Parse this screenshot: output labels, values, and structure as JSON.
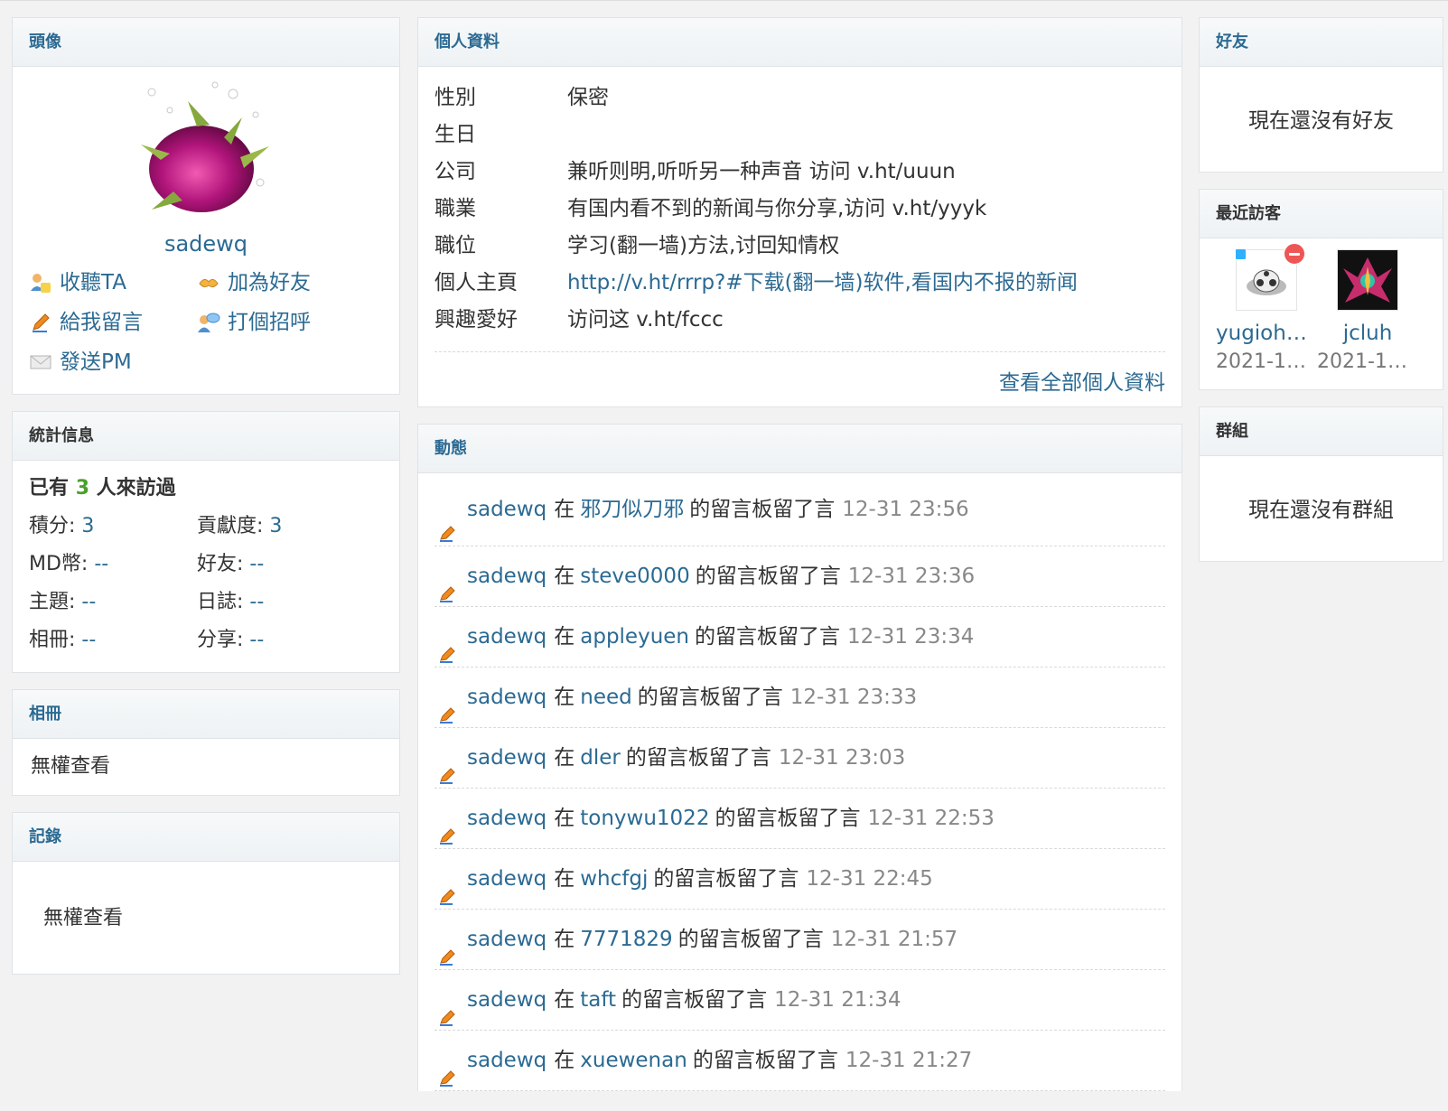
{
  "avatar_box": {
    "title": "頭像",
    "username": "sadewq",
    "actions": [
      {
        "label": "收聽TA",
        "icon": "follow-icon"
      },
      {
        "label": "加為好友",
        "icon": "add-friend-icon"
      },
      {
        "label": "給我留言",
        "icon": "pencil-icon"
      },
      {
        "label": "打個招呼",
        "icon": "greet-icon"
      },
      {
        "label": "發送PM",
        "icon": "mail-icon"
      }
    ]
  },
  "stats_box": {
    "title": "統計信息",
    "visited_prefix": "已有",
    "visited_count": "3",
    "visited_suffix": "人來訪過",
    "items": [
      {
        "label": "積分: ",
        "value": "3"
      },
      {
        "label": "貢獻度: ",
        "value": "3"
      },
      {
        "label": "MD幣: ",
        "value": "--"
      },
      {
        "label": "好友: ",
        "value": "--"
      },
      {
        "label": "主題: ",
        "value": "--"
      },
      {
        "label": "日誌: ",
        "value": "--"
      },
      {
        "label": "相冊: ",
        "value": "--"
      },
      {
        "label": "分享: ",
        "value": "--"
      }
    ]
  },
  "album_box": {
    "title": "相冊",
    "text": "無權查看"
  },
  "record_box": {
    "title": "記錄",
    "text": "無權查看"
  },
  "profile_box": {
    "title": "個人資料",
    "rows": [
      {
        "key": "性別",
        "value": "保密"
      },
      {
        "key": "生日",
        "value": ""
      },
      {
        "key": "公司",
        "value": "兼听则明,听听另一种声音 访问 v.ht/uuun"
      },
      {
        "key": "職業",
        "value": "有国内看不到的新闻与你分享,访问 v.ht/yyyk"
      },
      {
        "key": "職位",
        "value": "学习(翻一墙)方法,讨回知情权"
      },
      {
        "key": "個人主頁",
        "value": "http://v.ht/rrrp?#下载(翻一墙)软件,看国内不报的新闻"
      },
      {
        "key": "興趣愛好",
        "value": "访问这 v.ht/fccc"
      }
    ],
    "more_link": "查看全部個人資料"
  },
  "feed_box": {
    "title": "動態",
    "connector": "在",
    "suffix": "的留言板留了言",
    "items": [
      {
        "user": "sadewq",
        "target": "邪刀似刀邪",
        "time": "12-31 23:56"
      },
      {
        "user": "sadewq",
        "target": "steve0000",
        "time": "12-31 23:36"
      },
      {
        "user": "sadewq",
        "target": "appleyuen",
        "time": "12-31 23:34"
      },
      {
        "user": "sadewq",
        "target": "need",
        "time": "12-31 23:33"
      },
      {
        "user": "sadewq",
        "target": "dler",
        "time": "12-31 23:03"
      },
      {
        "user": "sadewq",
        "target": "tonywu1022",
        "time": "12-31 22:53"
      },
      {
        "user": "sadewq",
        "target": "whcfgj",
        "time": "12-31 22:45"
      },
      {
        "user": "sadewq",
        "target": "7771829",
        "time": "12-31 21:57"
      },
      {
        "user": "sadewq",
        "target": "taft",
        "time": "12-31 21:34"
      },
      {
        "user": "sadewq",
        "target": "xuewenan",
        "time": "12-31 21:27"
      }
    ]
  },
  "friends_box": {
    "title": "好友",
    "empty": "現在還沒有好友"
  },
  "visitors_box": {
    "title": "最近訪客",
    "visitors": [
      {
        "name": "yugioh0...",
        "date": "2021-12..."
      },
      {
        "name": "jcluh",
        "date": "2021-12..."
      }
    ]
  },
  "groups_box": {
    "title": "群組",
    "empty": "現在還沒有群組"
  }
}
